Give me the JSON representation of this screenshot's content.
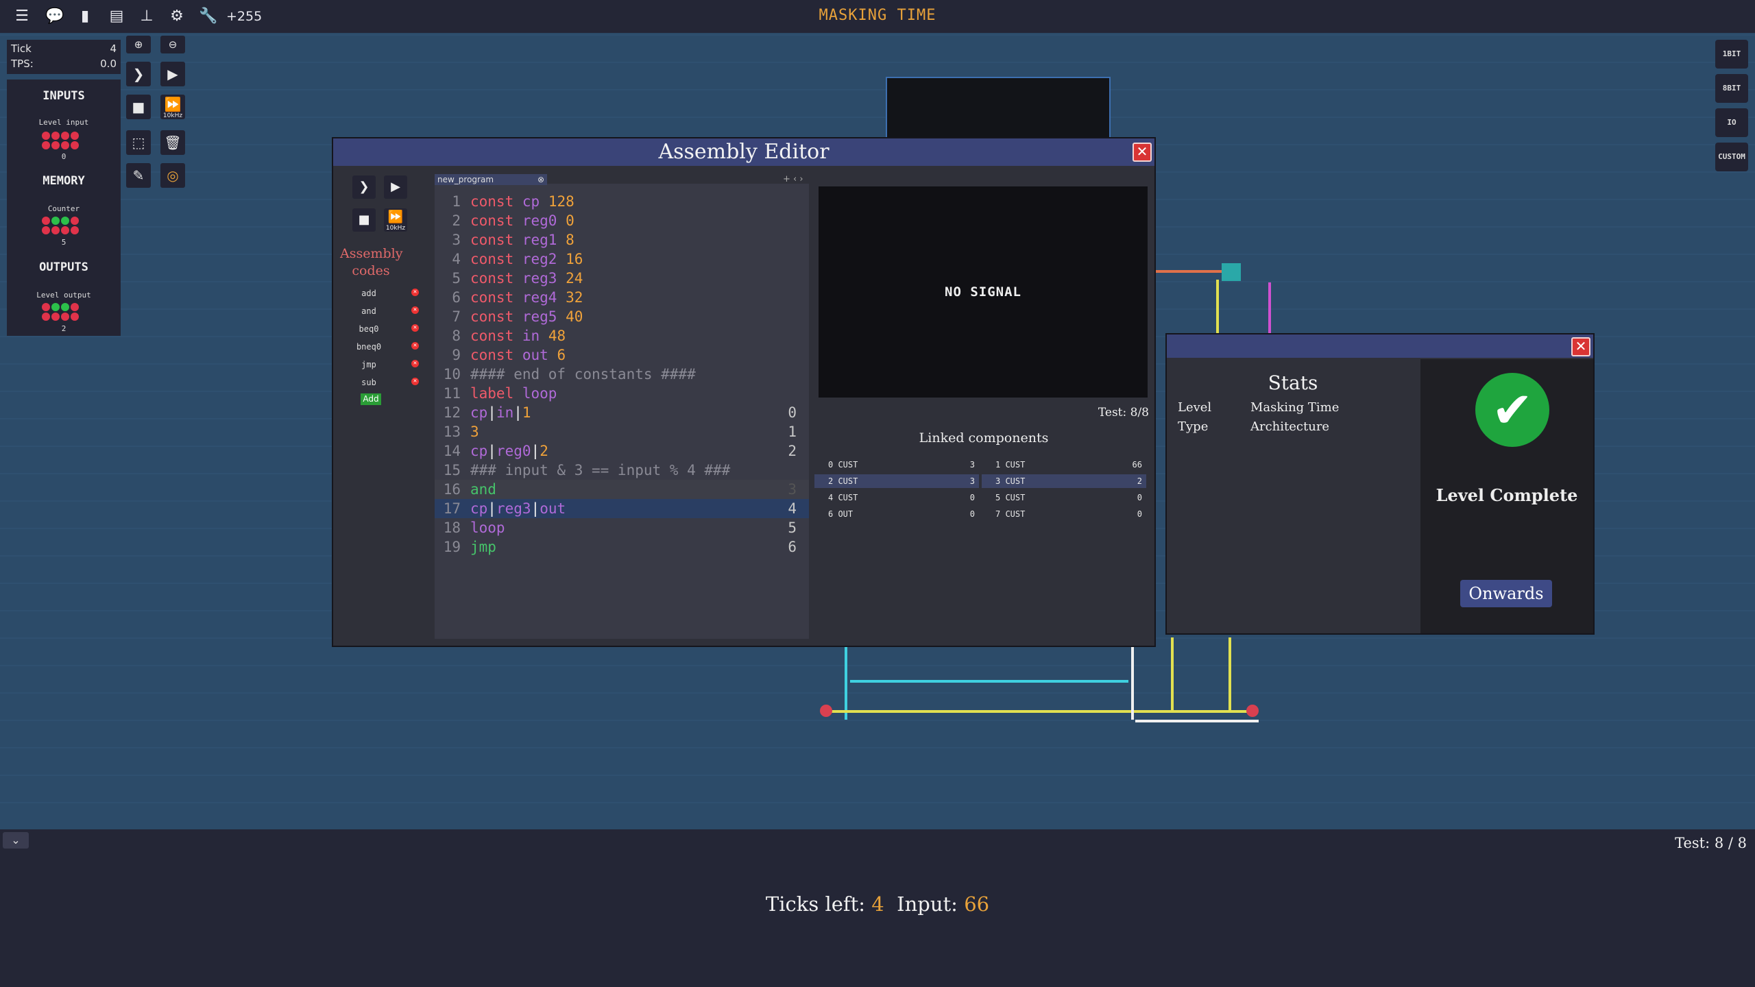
{
  "topbar": {
    "score": "+255",
    "level_title": "MASKING TIME",
    "icons": [
      "menu-icon",
      "chat-icon",
      "file-icon",
      "book-icon",
      "hierarchy-icon",
      "gear-icon",
      "wrench-icon"
    ]
  },
  "tick_panel": {
    "tick_label": "Tick",
    "tick_value": "4",
    "tps_label": "TPS:",
    "tps_value": "0.0"
  },
  "side_panel": {
    "inputs_title": "INPUTS",
    "level_input_label": "Level input",
    "level_input_value": "0",
    "memory_title": "MEMORY",
    "counter_label": "Counter",
    "counter_value": "5",
    "outputs_title": "OUTPUTS",
    "level_output_label": "Level output",
    "level_output_value": "2"
  },
  "tools": {
    "speed_label": "10kHz"
  },
  "right_tools": [
    "1BIT",
    "8BIT",
    "IO",
    "CUSTOM"
  ],
  "editor": {
    "title": "Assembly Editor",
    "codes_title": "Assembly codes",
    "codes": [
      "add",
      "and",
      "beq0",
      "bneq0",
      "jmp",
      "sub"
    ],
    "add_label": "Add",
    "tab_name": "new_program",
    "speed_label": "10kHz",
    "screen_text": "NO SIGNAL",
    "test_label": "Test: 8/8",
    "linked_title": "Linked components",
    "linked": [
      {
        "name": "0 CUST",
        "value": "3"
      },
      {
        "name": "1 CUST",
        "value": "66"
      },
      {
        "name": "2 CUST",
        "value": "3"
      },
      {
        "name": "3 CUST",
        "value": "2"
      },
      {
        "name": "4 CUST",
        "value": "0"
      },
      {
        "name": "5 CUST",
        "value": "0"
      },
      {
        "name": "6 OUT",
        "value": "0"
      },
      {
        "name": "7 CUST",
        "value": "0"
      }
    ]
  },
  "stats": {
    "title": "Stats",
    "level_label": "Level",
    "level_value": "Masking Time",
    "type_label": "Type",
    "type_value": "Architecture",
    "complete_label": "Level Complete",
    "onwards_label": "Onwards"
  },
  "bottom": {
    "test_label": "Test: 8 / 8",
    "ticks_left_label": "Ticks left:",
    "ticks_left_value": "4",
    "input_label": "Input:",
    "input_value": "66"
  },
  "colors": {
    "accent": "#e8a23a",
    "title_bar": "#3a4478",
    "success": "#1fa53e"
  }
}
